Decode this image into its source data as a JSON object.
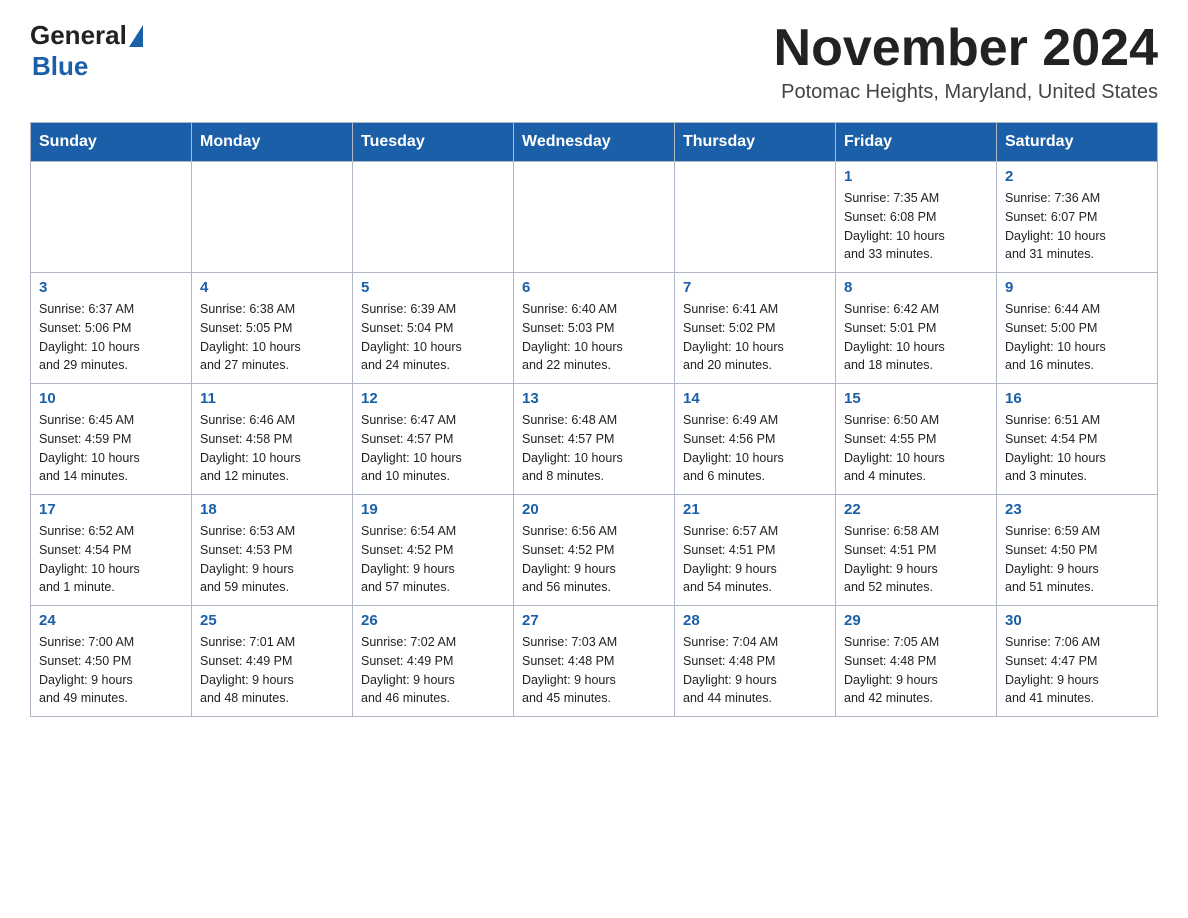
{
  "header": {
    "logo_general": "General",
    "logo_blue": "Blue",
    "month_title": "November 2024",
    "location": "Potomac Heights, Maryland, United States"
  },
  "days_of_week": [
    "Sunday",
    "Monday",
    "Tuesday",
    "Wednesday",
    "Thursday",
    "Friday",
    "Saturday"
  ],
  "weeks": [
    {
      "days": [
        {
          "num": "",
          "info": ""
        },
        {
          "num": "",
          "info": ""
        },
        {
          "num": "",
          "info": ""
        },
        {
          "num": "",
          "info": ""
        },
        {
          "num": "",
          "info": ""
        },
        {
          "num": "1",
          "info": "Sunrise: 7:35 AM\nSunset: 6:08 PM\nDaylight: 10 hours\nand 33 minutes."
        },
        {
          "num": "2",
          "info": "Sunrise: 7:36 AM\nSunset: 6:07 PM\nDaylight: 10 hours\nand 31 minutes."
        }
      ]
    },
    {
      "days": [
        {
          "num": "3",
          "info": "Sunrise: 6:37 AM\nSunset: 5:06 PM\nDaylight: 10 hours\nand 29 minutes."
        },
        {
          "num": "4",
          "info": "Sunrise: 6:38 AM\nSunset: 5:05 PM\nDaylight: 10 hours\nand 27 minutes."
        },
        {
          "num": "5",
          "info": "Sunrise: 6:39 AM\nSunset: 5:04 PM\nDaylight: 10 hours\nand 24 minutes."
        },
        {
          "num": "6",
          "info": "Sunrise: 6:40 AM\nSunset: 5:03 PM\nDaylight: 10 hours\nand 22 minutes."
        },
        {
          "num": "7",
          "info": "Sunrise: 6:41 AM\nSunset: 5:02 PM\nDaylight: 10 hours\nand 20 minutes."
        },
        {
          "num": "8",
          "info": "Sunrise: 6:42 AM\nSunset: 5:01 PM\nDaylight: 10 hours\nand 18 minutes."
        },
        {
          "num": "9",
          "info": "Sunrise: 6:44 AM\nSunset: 5:00 PM\nDaylight: 10 hours\nand 16 minutes."
        }
      ]
    },
    {
      "days": [
        {
          "num": "10",
          "info": "Sunrise: 6:45 AM\nSunset: 4:59 PM\nDaylight: 10 hours\nand 14 minutes."
        },
        {
          "num": "11",
          "info": "Sunrise: 6:46 AM\nSunset: 4:58 PM\nDaylight: 10 hours\nand 12 minutes."
        },
        {
          "num": "12",
          "info": "Sunrise: 6:47 AM\nSunset: 4:57 PM\nDaylight: 10 hours\nand 10 minutes."
        },
        {
          "num": "13",
          "info": "Sunrise: 6:48 AM\nSunset: 4:57 PM\nDaylight: 10 hours\nand 8 minutes."
        },
        {
          "num": "14",
          "info": "Sunrise: 6:49 AM\nSunset: 4:56 PM\nDaylight: 10 hours\nand 6 minutes."
        },
        {
          "num": "15",
          "info": "Sunrise: 6:50 AM\nSunset: 4:55 PM\nDaylight: 10 hours\nand 4 minutes."
        },
        {
          "num": "16",
          "info": "Sunrise: 6:51 AM\nSunset: 4:54 PM\nDaylight: 10 hours\nand 3 minutes."
        }
      ]
    },
    {
      "days": [
        {
          "num": "17",
          "info": "Sunrise: 6:52 AM\nSunset: 4:54 PM\nDaylight: 10 hours\nand 1 minute."
        },
        {
          "num": "18",
          "info": "Sunrise: 6:53 AM\nSunset: 4:53 PM\nDaylight: 9 hours\nand 59 minutes."
        },
        {
          "num": "19",
          "info": "Sunrise: 6:54 AM\nSunset: 4:52 PM\nDaylight: 9 hours\nand 57 minutes."
        },
        {
          "num": "20",
          "info": "Sunrise: 6:56 AM\nSunset: 4:52 PM\nDaylight: 9 hours\nand 56 minutes."
        },
        {
          "num": "21",
          "info": "Sunrise: 6:57 AM\nSunset: 4:51 PM\nDaylight: 9 hours\nand 54 minutes."
        },
        {
          "num": "22",
          "info": "Sunrise: 6:58 AM\nSunset: 4:51 PM\nDaylight: 9 hours\nand 52 minutes."
        },
        {
          "num": "23",
          "info": "Sunrise: 6:59 AM\nSunset: 4:50 PM\nDaylight: 9 hours\nand 51 minutes."
        }
      ]
    },
    {
      "days": [
        {
          "num": "24",
          "info": "Sunrise: 7:00 AM\nSunset: 4:50 PM\nDaylight: 9 hours\nand 49 minutes."
        },
        {
          "num": "25",
          "info": "Sunrise: 7:01 AM\nSunset: 4:49 PM\nDaylight: 9 hours\nand 48 minutes."
        },
        {
          "num": "26",
          "info": "Sunrise: 7:02 AM\nSunset: 4:49 PM\nDaylight: 9 hours\nand 46 minutes."
        },
        {
          "num": "27",
          "info": "Sunrise: 7:03 AM\nSunset: 4:48 PM\nDaylight: 9 hours\nand 45 minutes."
        },
        {
          "num": "28",
          "info": "Sunrise: 7:04 AM\nSunset: 4:48 PM\nDaylight: 9 hours\nand 44 minutes."
        },
        {
          "num": "29",
          "info": "Sunrise: 7:05 AM\nSunset: 4:48 PM\nDaylight: 9 hours\nand 42 minutes."
        },
        {
          "num": "30",
          "info": "Sunrise: 7:06 AM\nSunset: 4:47 PM\nDaylight: 9 hours\nand 41 minutes."
        }
      ]
    }
  ]
}
